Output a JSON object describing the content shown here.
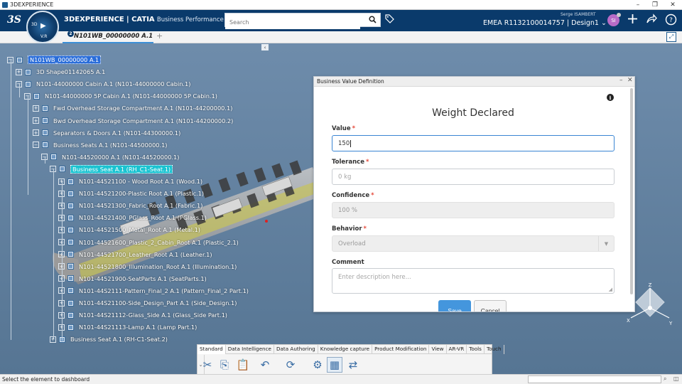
{
  "window": {
    "title": "3DEXPERIENCE",
    "controls": [
      "–",
      "❐",
      "✕"
    ]
  },
  "topbar": {
    "logo_text": "3S",
    "compass": {
      "label_3d": "3D",
      "play": "▶",
      "version": "V.R"
    },
    "brand_bold": "3D",
    "brand_rest": "EXPERIENCE",
    "brand_app": "| CATIA",
    "app_name": "Business Performance Asse...",
    "search_placeholder": "Search",
    "user_name": "Serge ISAMBERT",
    "tenant": "EMEA R1132100014757 | Design1",
    "tenant_caret": "⌄",
    "avatar_initials": "SI",
    "icons": [
      "search-icon",
      "tag-icon",
      "add-icon",
      "share-icon",
      "help-icon"
    ]
  },
  "tabbar": {
    "active_tab": "N101WB_00000000 A.1",
    "tab_badge": "2",
    "add_tab": "+"
  },
  "tree": {
    "collapse_glyph": "‹",
    "nodes": [
      {
        "label": "N101WB_00000000 A.1",
        "state": "selected",
        "exp": "−"
      },
      {
        "label": "3D Shape01142065 A.1",
        "exp": "+"
      },
      {
        "label": "N101-44000000 Cabin A.1 (N101-44000000 Cabin.1)",
        "exp": "−"
      },
      {
        "label": "N101-44000000 5P Cabin A.1 (N101-44000000 5P Cabin.1)",
        "exp": "−"
      },
      {
        "label": "Fwd Overhead Storage Compartment A.1 (N101-44200000.1)",
        "exp": "+"
      },
      {
        "label": "Bwd Overhead Storage Compartment A.1 (N101-44200000.2)",
        "exp": "+"
      },
      {
        "label": "Separators & Doors A.1 (N101-44300000.1)",
        "exp": "+"
      },
      {
        "label": "Business Seats A.1 (N101-44500000.1)",
        "exp": "−"
      },
      {
        "label": "N101-44520000 A.1 (N101-44520000.1)",
        "exp": "−"
      },
      {
        "label": "Business Seat A.1 (RH_C1-Seat.1)",
        "state": "highlight",
        "exp": "−"
      },
      {
        "label": "N101-44521100 - Wood Root A.1 (Wood.1)",
        "exp": "+"
      },
      {
        "label": "N101-44521200-Plastic Root A.1 (Plastic.1)",
        "exp": "+"
      },
      {
        "label": "N101-44521300_Fabric_Root A.1 (Fabric.1)",
        "exp": "+"
      },
      {
        "label": "N101-44521400_PGlass_Root A.1 (PGlass.1)",
        "exp": "+"
      },
      {
        "label": "N101-44521500_Metal_Root A.1 (Metal.1)",
        "exp": "+"
      },
      {
        "label": "N101-44521600_Plastic_2_Cabin_Root A.1 (Plastic_2.1)",
        "exp": "+"
      },
      {
        "label": "N101-44521700_Leather_Root A.1 (Leather.1)",
        "exp": "+"
      },
      {
        "label": "N101-44521800_Illumination_Root A.1 (Illumination.1)",
        "exp": "+"
      },
      {
        "label": "N101-44521900-SeatParts A.1 (SeatParts.1)",
        "exp": "+"
      },
      {
        "label": "N101-44S2111-Pattern_Final_2 A.1 (Pattern_Final_2 Part.1)",
        "exp": "+"
      },
      {
        "label": "N101-44S21100-Side_Design_Part A.1 (Side_Design.1)",
        "exp": "+"
      },
      {
        "label": "N101-44S21112-Glass_Side A.1 (Glass_Side Part.1)",
        "exp": "+"
      },
      {
        "label": "N101-44S21113-Lamp A.1 (Lamp Part.1)",
        "exp": "+"
      },
      {
        "label": "Business Seat A.1 (RH-C1-Seat.2)",
        "exp": "+"
      }
    ]
  },
  "dialog": {
    "title": "Business Value Definition",
    "minimize": "–",
    "close": "✕",
    "info": "i",
    "heading": "Weight Declared",
    "required_mark": "*",
    "fields": {
      "value": {
        "label": "Value",
        "value": "150"
      },
      "tolerance": {
        "label": "Tolerance",
        "placeholder": "0 kg"
      },
      "confidence": {
        "label": "Confidence",
        "value": "100 %"
      },
      "behavior": {
        "label": "Behavior",
        "value": "Overload",
        "caret": "▼"
      },
      "comment": {
        "label": "Comment",
        "placeholder": "Enter description here..."
      }
    },
    "save_label": "Save",
    "cancel_label": "Cancel"
  },
  "triad": {
    "axis_x": "X",
    "axis_y": "Y",
    "axis_z": "Z"
  },
  "action_bar": {
    "tabs": [
      "Standard",
      "Data Intelligence",
      "Data Authoring",
      "Knowledge capture",
      "Product Modification",
      "View",
      "AR-VR",
      "Tools",
      "Touch"
    ],
    "active_tab": "Standard",
    "dropdown_glyph": "⌄",
    "commands": [
      {
        "name": "cut-icon",
        "glyph": "✂"
      },
      {
        "name": "copy-icon",
        "glyph": "⎘"
      },
      {
        "name": "paste-icon",
        "glyph": "📋"
      },
      {
        "name": "undo-icon",
        "glyph": "↶"
      },
      {
        "name": "update-icon",
        "glyph": "⟳"
      },
      {
        "name": "edit-values-icon",
        "glyph": "⚙"
      },
      {
        "name": "business-value-icon",
        "glyph": "▦"
      },
      {
        "name": "analysis-icon",
        "glyph": "⇄"
      }
    ]
  },
  "statusbar": {
    "message": "Select the element to dashboard"
  }
}
